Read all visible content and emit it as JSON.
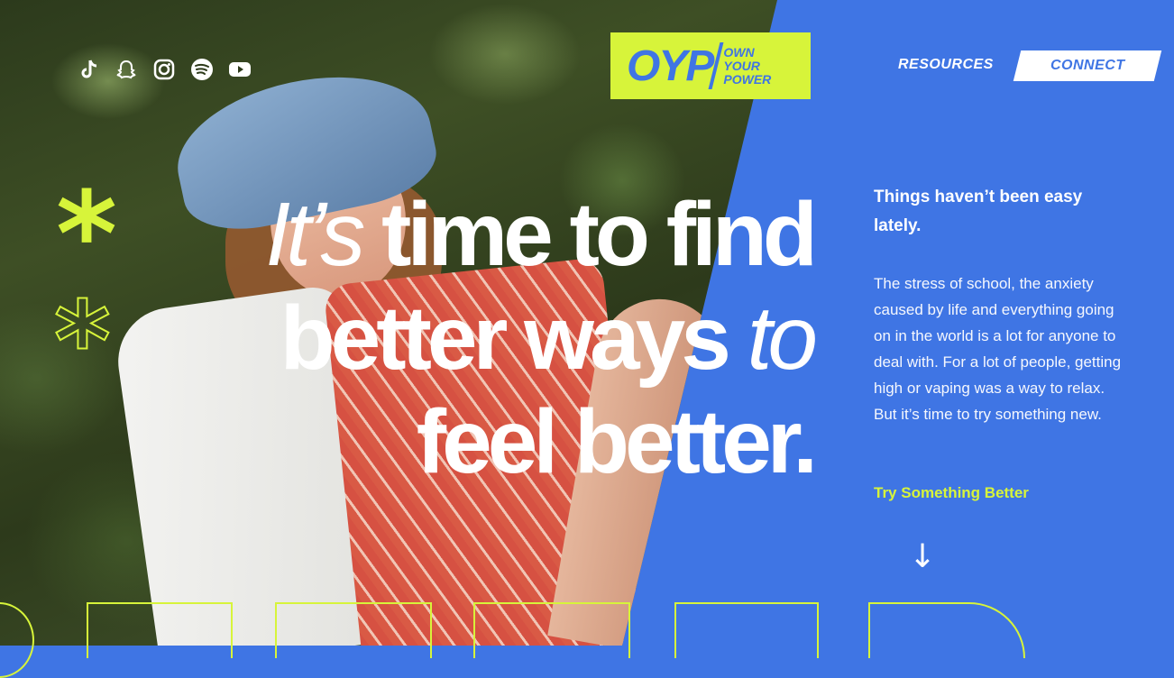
{
  "social": [
    {
      "icon": "tiktok-icon",
      "glyph": "♪"
    },
    {
      "icon": "snapchat-icon",
      "glyph": "👻"
    },
    {
      "icon": "instagram-icon",
      "glyph": "◎"
    },
    {
      "icon": "spotify-icon",
      "glyph": "≋"
    },
    {
      "icon": "youtube-icon",
      "glyph": "▶"
    }
  ],
  "logo": {
    "main": "OYP",
    "line1": "OWN",
    "line2": "YOUR",
    "line3": "POWER"
  },
  "nav": {
    "resources": "RESOURCES",
    "connect": "CONNECT"
  },
  "hero": {
    "word1": "It’s",
    "line1": " time to find",
    "line2a": "better ways ",
    "line2b": "to",
    "line3": "feel better."
  },
  "side": {
    "title": "Things haven’t been easy lately.",
    "body": "The stress of school, the anxiety caused by life and everything going on in the world is a lot for anyone to deal with. For a lot of people, getting high or vaping was a way to relax. But it’s time to try something new.",
    "cta": "Try Something Better",
    "arrow": "↓"
  },
  "colors": {
    "blue": "#3f75e4",
    "lime": "#d7f43a",
    "white": "#ffffff"
  }
}
